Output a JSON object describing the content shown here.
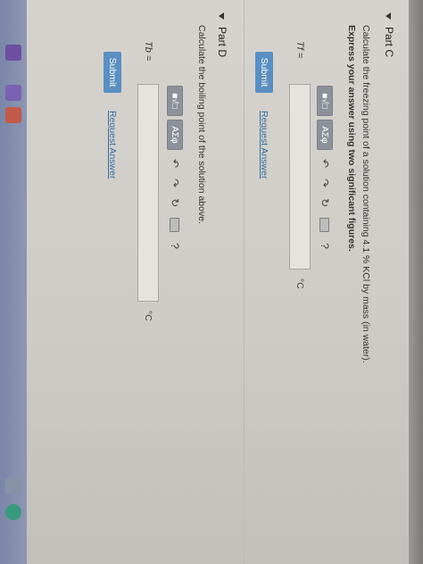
{
  "part_c": {
    "title": "Part C",
    "question": "Calculate the freezing point of a solution containing 4.1 % KCl by mass (in water).",
    "instruction": "Express your answer using two significant figures.",
    "toolbar": {
      "templates": "■√□",
      "symbols": "AΣφ"
    },
    "var_label": "Tf =",
    "unit": "°C",
    "submit_label": "Submit",
    "request_label": "Request Answer"
  },
  "part_d": {
    "title": "Part D",
    "question": "Calculate the boiling point of the solution above.",
    "toolbar": {
      "templates": "■√□",
      "symbols": "AΣφ"
    },
    "var_label": "Tb =",
    "unit": "°C",
    "submit_label": "Submit",
    "request_label": "Request Answer"
  },
  "icons": {
    "undo": "↶",
    "redo": "↷",
    "reset": "↻",
    "help": "?"
  },
  "colors": {
    "submit": "#5a8fc2",
    "link": "#3a6ea2"
  }
}
